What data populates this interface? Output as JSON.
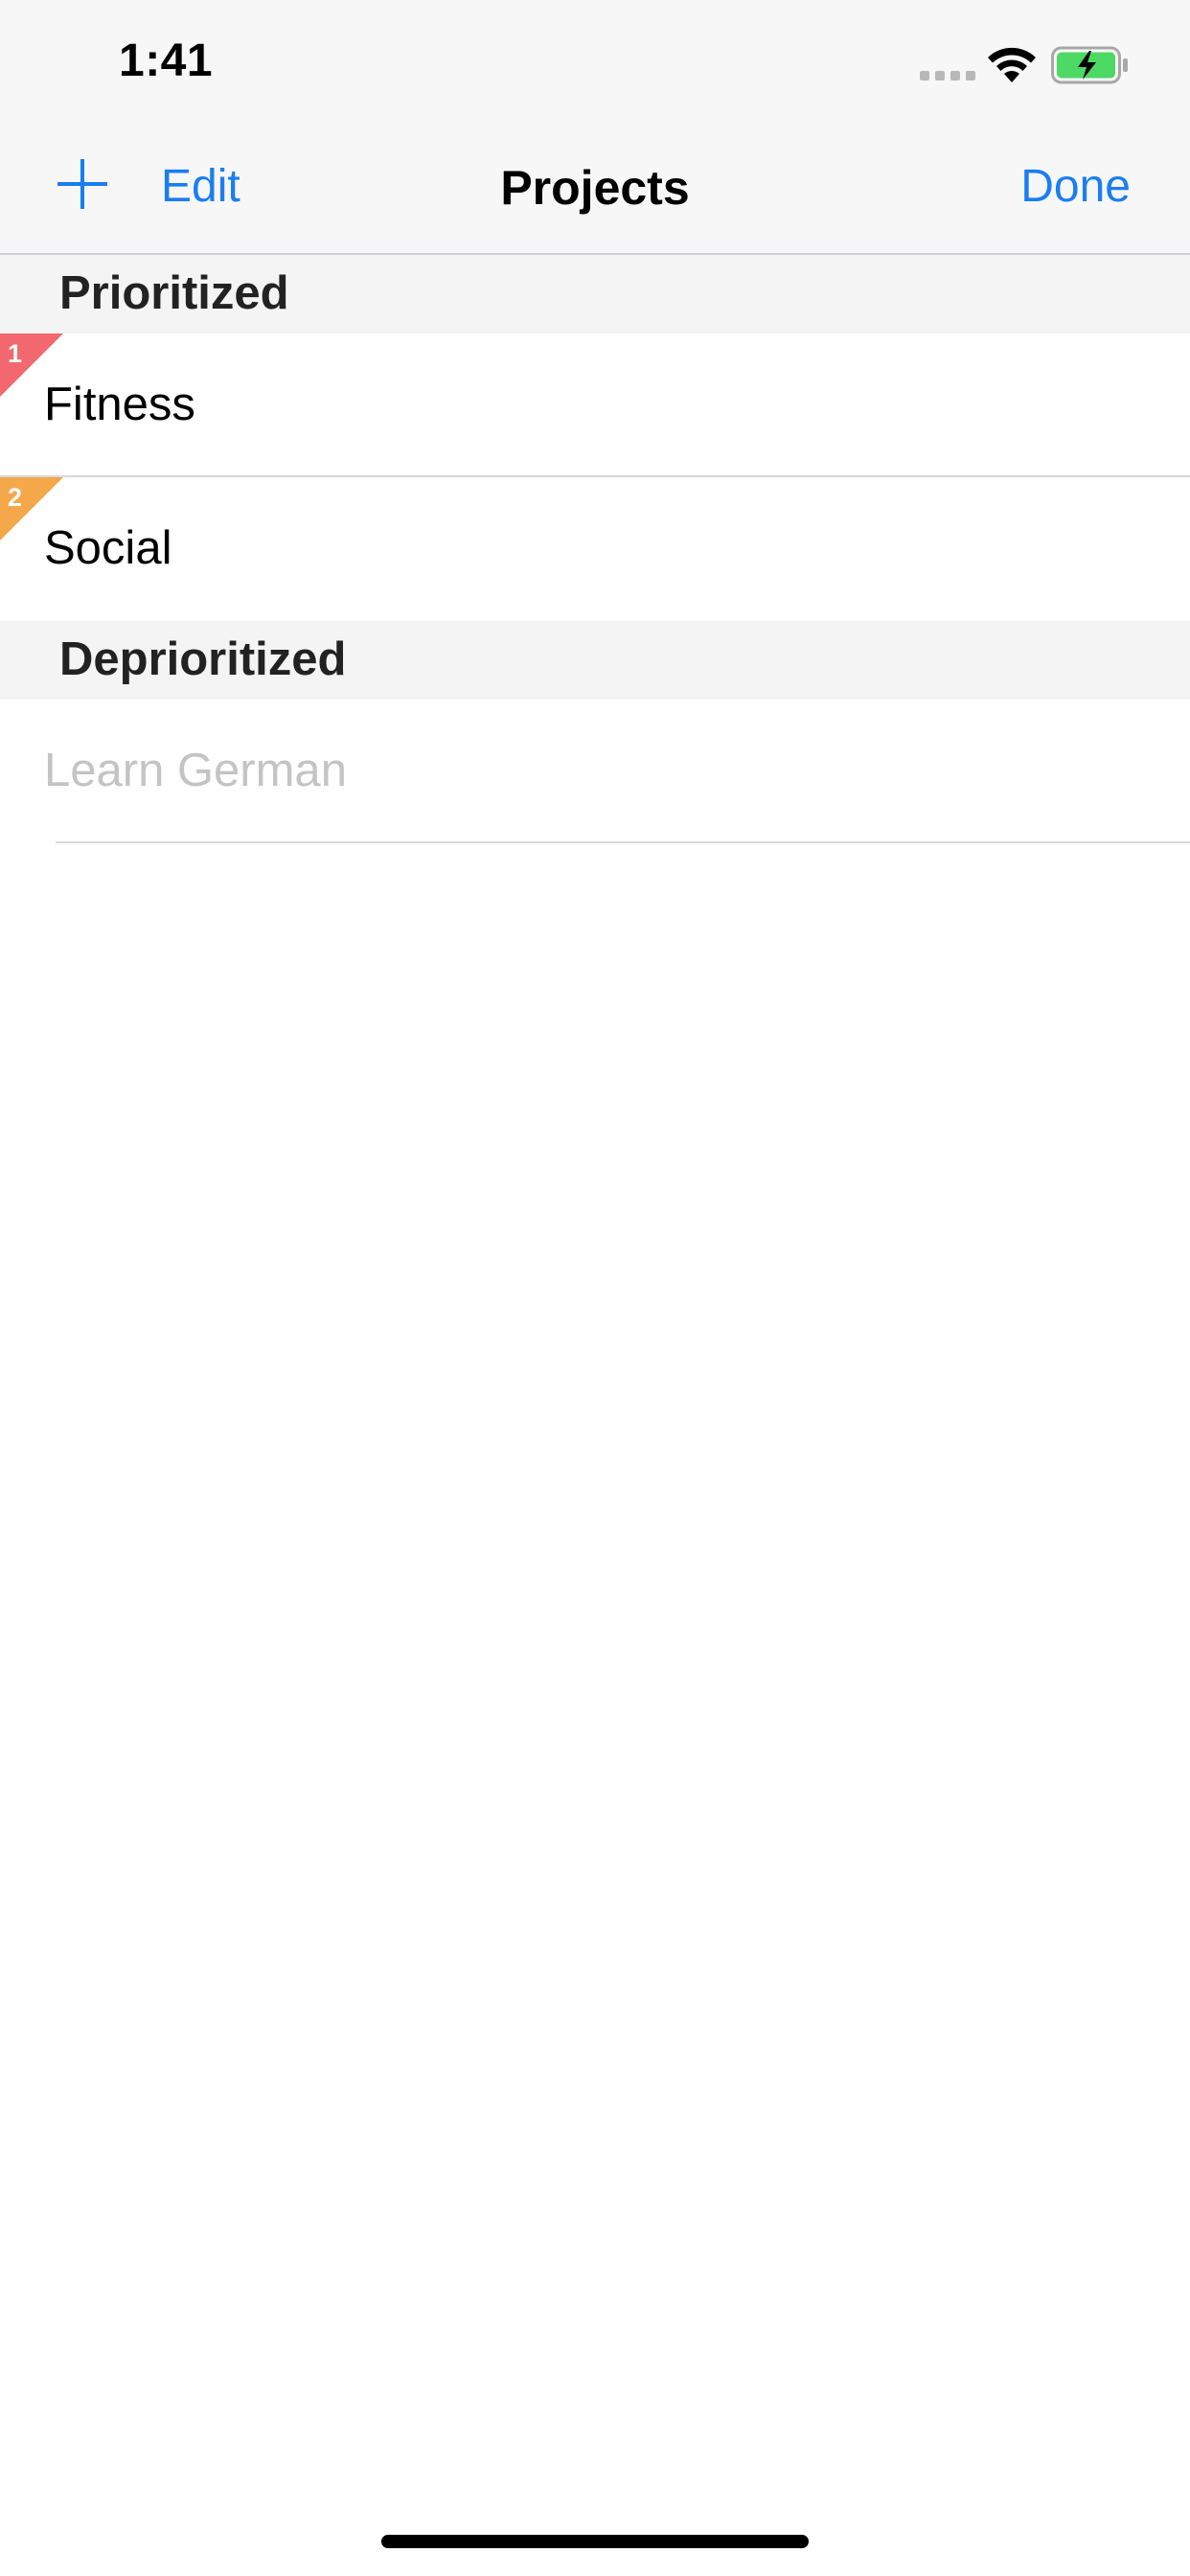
{
  "status_bar": {
    "time": "1:41",
    "signal_icon": "cellular-signal-icon",
    "wifi_icon": "wifi-icon",
    "battery_icon": "battery-charging-icon",
    "battery_color": "#4cd964"
  },
  "nav": {
    "add_icon": "plus-icon",
    "edit_label": "Edit",
    "title": "Projects",
    "done_label": "Done",
    "accent_color": "#1a7ef2"
  },
  "sections": [
    {
      "title": "Prioritized",
      "rows": [
        {
          "label": "Fitness",
          "rank": "1",
          "rank_color": "#f2686e"
        },
        {
          "label": "Social",
          "rank": "2",
          "rank_color": "#f4a84a"
        }
      ]
    },
    {
      "title": "Deprioritized",
      "rows": [
        {
          "label": "Learn German"
        }
      ]
    }
  ]
}
